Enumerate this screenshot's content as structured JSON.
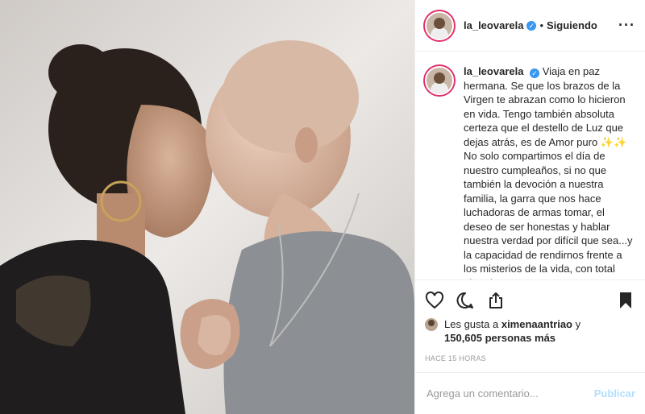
{
  "post": {
    "author": {
      "username": "la_leovarela",
      "verified": true,
      "follow_status": "Siguiendo"
    },
    "caption": {
      "username": "la_leovarela",
      "text": "Viaja en paz hermana. Se que los brazos de la Virgen te abrazan como lo hicieron en vida. Tengo también absoluta certeza que el destello de Luz que dejas atrás, es de Amor puro ✨✨\nNo solo compartimos el día de nuestro cumpleaños, si no que también la devoción a nuestra familia, la garra que nos hace luchadoras de armas tomar, el deseo de ser honestas y hablar nuestra verdad por difícil que sea...y la capacidad de rendirnos frente a los misterios de la vida, con total abandono.\nFe. Amor. Fuerza. Eso fuiste y serás siempre para mi amiga. Mis pensamientos de apoyo y amor van para Cristian, Bodyto Mila y ..."
    },
    "likes": {
      "prefix": "Les gusta a",
      "first_user": "ximenaantriao",
      "joiner": "y",
      "count_text": "150,605 personas más"
    },
    "timestamp": "HACE 15 HORAS",
    "comment_box": {
      "placeholder": "Agrega un comentario...",
      "publish_label": "Publicar"
    },
    "icons": {
      "like": "heart-icon",
      "comment": "comment-icon",
      "share": "share-icon",
      "save": "bookmark-icon",
      "more": "more-options-icon"
    },
    "colors": {
      "verified": "#3897f0",
      "publish_disabled": "#b2dffc",
      "border": "#efefef",
      "story_ring": "#e1306c"
    }
  }
}
